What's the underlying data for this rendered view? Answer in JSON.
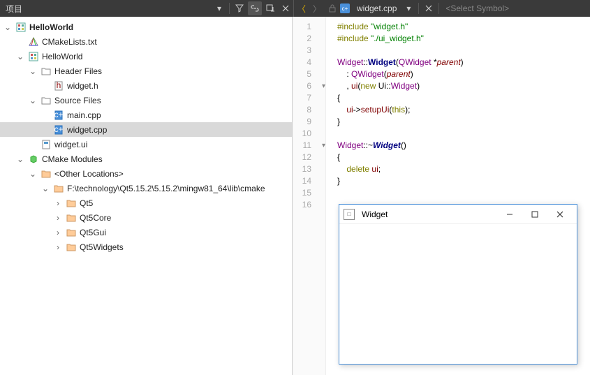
{
  "toolbar": {
    "left_label": "项目",
    "tab_name": "widget.cpp",
    "select_symbol": "<Select Symbol>"
  },
  "tree": {
    "helloworld": "HelloWorld",
    "cmakelists": "CMakeLists.txt",
    "helloworld2": "HelloWorld",
    "header_files": "Header Files",
    "widget_h": "widget.h",
    "source_files": "Source Files",
    "main_cpp": "main.cpp",
    "widget_cpp": "widget.cpp",
    "widget_ui": "widget.ui",
    "cmake_modules": "CMake Modules",
    "other_locations": "<Other Locations>",
    "lib_path": "F:\\technology\\Qt5.15.2\\5.15.2\\mingw81_64\\lib\\cmake",
    "qt5": "Qt5",
    "qt5core": "Qt5Core",
    "qt5gui": "Qt5Gui",
    "qt5widgets": "Qt5Widgets"
  },
  "code": {
    "lines": {
      "l1a": "#include ",
      "l1b": "\"widget.h\"",
      "l2a": "#include ",
      "l2b": "\"./ui_widget.h\"",
      "l4a": "Widget",
      "l4b": "::",
      "l4c": "Widget",
      "l4d": "(",
      "l4e": "QWidget",
      "l4f": " *",
      "l4g": "parent",
      "l4h": ")",
      "l5a": "    : ",
      "l5b": "QWidget",
      "l5c": "(",
      "l5d": "parent",
      "l5e": ")",
      "l6a": "    , ",
      "l6b": "ui",
      "l6c": "(",
      "l6d": "new",
      "l6e": " Ui::",
      "l6f": "Widget",
      "l6g": ")",
      "l7": "{",
      "l8a": "    ",
      "l8b": "ui",
      "l8c": "->",
      "l8d": "setupUi",
      "l8e": "(",
      "l8f": "this",
      "l8g": ");",
      "l9": "}",
      "l11a": "Widget",
      "l11b": "::~",
      "l11c": "Widget",
      "l11d": "()",
      "l12": "{",
      "l13a": "    ",
      "l13b": "delete",
      "l13c": " ",
      "l13d": "ui",
      "l13e": ";",
      "l14": "}"
    },
    "gutter": [
      "1",
      "2",
      "3",
      "4",
      "5",
      "6",
      "7",
      "8",
      "9",
      "10",
      "11",
      "12",
      "13",
      "14",
      "15",
      "16"
    ]
  },
  "popup": {
    "title": "Widget"
  }
}
